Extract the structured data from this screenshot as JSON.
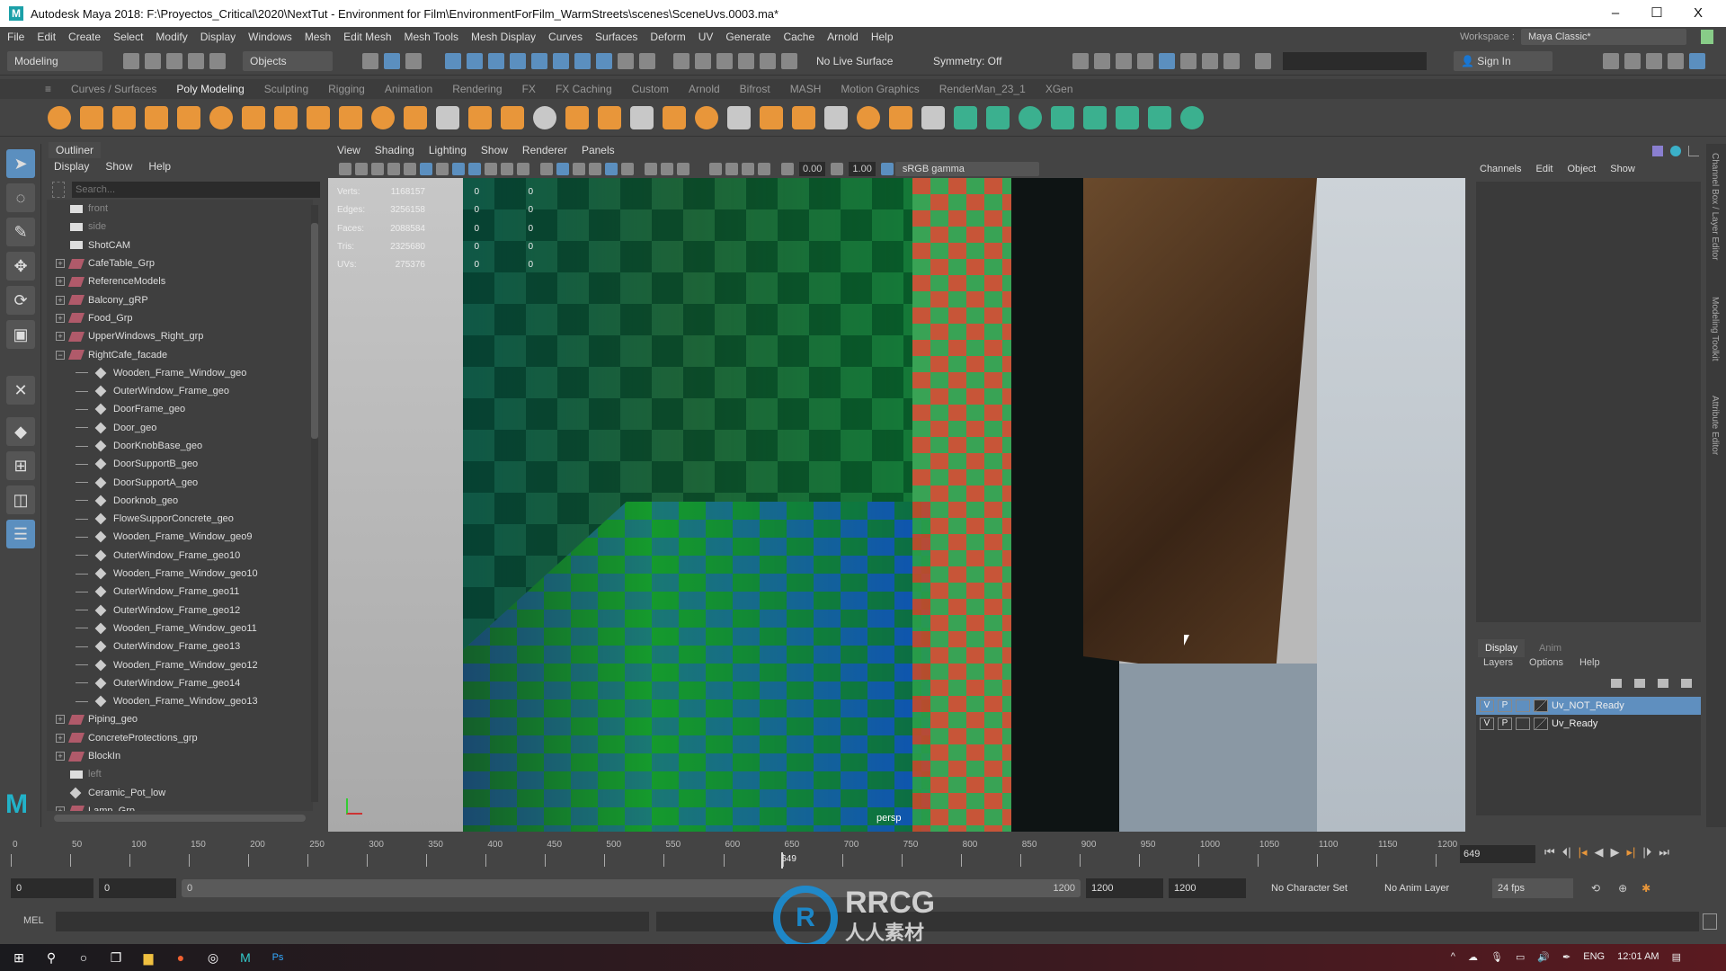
{
  "window": {
    "title": "Autodesk Maya 2018: F:\\Proyectos_Critical\\2020\\NextTut - Environment for Film\\EnvironmentForFilm_WarmStreets\\scenes\\SceneUvs.0003.ma*",
    "minimize": "–",
    "maximize": "☐",
    "close": "X"
  },
  "menubar": {
    "items": [
      "File",
      "Edit",
      "Create",
      "Select",
      "Modify",
      "Display",
      "Windows",
      "Mesh",
      "Edit Mesh",
      "Mesh Tools",
      "Mesh Display",
      "Curves",
      "Surfaces",
      "Deform",
      "UV",
      "Generate",
      "Cache",
      "Arnold",
      "Help"
    ],
    "workspace_label": "Workspace :",
    "workspace_value": "Maya Classic*"
  },
  "statusline": {
    "mode": "Modeling",
    "selection_mode": "Objects",
    "live_surface": "No Live Surface",
    "symmetry": "Symmetry: Off",
    "sign_in": "Sign In"
  },
  "shelf": {
    "tabs": [
      "Curves / Surfaces",
      "Poly Modeling",
      "Sculpting",
      "Rigging",
      "Animation",
      "Rendering",
      "FX",
      "FX Caching",
      "Custom",
      "Arnold",
      "Bifrost",
      "MASH",
      "Motion Graphics",
      "RenderMan_23_1",
      "XGen"
    ],
    "active_tab": "Poly Modeling",
    "icons": [
      "sphere",
      "cube",
      "cylinder",
      "cone",
      "torus",
      "plane",
      "disc",
      "platonic",
      "super-shape",
      "type",
      "svg",
      "combine",
      "separate",
      "extract",
      "smooth",
      "bool",
      "mirror",
      "bridge",
      "extrude",
      "bevel",
      "fill-hole",
      "append",
      "multi-cut",
      "target-weld",
      "connect",
      "quad-draw",
      "uv-editor",
      "planar-uv",
      "automatic-uv",
      "camera-uv",
      "cut-uv",
      "sew-uv",
      "unfold",
      "layout",
      "checker",
      "uv-snapshot"
    ],
    "accent": "#e8963a",
    "uv_accent": "#3bb08f"
  },
  "outliner": {
    "tab": "Outliner",
    "menu": [
      "Display",
      "Show",
      "Help"
    ],
    "search_placeholder": "Search...",
    "items": [
      {
        "label": "front",
        "type": "camera",
        "depth": 0,
        "dim": true
      },
      {
        "label": "side",
        "type": "camera",
        "depth": 0,
        "dim": true
      },
      {
        "label": "ShotCAM",
        "type": "camera",
        "depth": 0
      },
      {
        "label": "CafeTable_Grp",
        "type": "group",
        "depth": 0,
        "expand": "+"
      },
      {
        "label": "ReferenceModels",
        "type": "group",
        "depth": 0,
        "expand": "+"
      },
      {
        "label": "Balcony_gRP",
        "type": "group",
        "depth": 0,
        "expand": "+"
      },
      {
        "label": "Food_Grp",
        "type": "group",
        "depth": 0,
        "expand": "+"
      },
      {
        "label": "UpperWindows_Right_grp",
        "type": "group",
        "depth": 0,
        "expand": "+"
      },
      {
        "label": "RightCafe_facade",
        "type": "group",
        "depth": 0,
        "expand": "−"
      },
      {
        "label": "Wooden_Frame_Window_geo",
        "type": "mesh",
        "depth": 1
      },
      {
        "label": "OuterWindow_Frame_geo",
        "type": "mesh",
        "depth": 1
      },
      {
        "label": "DoorFrame_geo",
        "type": "mesh",
        "depth": 1
      },
      {
        "label": "Door_geo",
        "type": "mesh",
        "depth": 1
      },
      {
        "label": "DoorKnobBase_geo",
        "type": "mesh",
        "depth": 1
      },
      {
        "label": "DoorSupportB_geo",
        "type": "mesh",
        "depth": 1
      },
      {
        "label": "DoorSupportA_geo",
        "type": "mesh",
        "depth": 1
      },
      {
        "label": "Doorknob_geo",
        "type": "mesh",
        "depth": 1
      },
      {
        "label": "FloweSupporConcrete_geo",
        "type": "mesh",
        "depth": 1
      },
      {
        "label": "Wooden_Frame_Window_geo9",
        "type": "mesh",
        "depth": 1
      },
      {
        "label": "OuterWindow_Frame_geo10",
        "type": "mesh",
        "depth": 1
      },
      {
        "label": "Wooden_Frame_Window_geo10",
        "type": "mesh",
        "depth": 1
      },
      {
        "label": "OuterWindow_Frame_geo11",
        "type": "mesh",
        "depth": 1
      },
      {
        "label": "OuterWindow_Frame_geo12",
        "type": "mesh",
        "depth": 1
      },
      {
        "label": "Wooden_Frame_Window_geo11",
        "type": "mesh",
        "depth": 1
      },
      {
        "label": "OuterWindow_Frame_geo13",
        "type": "mesh",
        "depth": 1
      },
      {
        "label": "Wooden_Frame_Window_geo12",
        "type": "mesh",
        "depth": 1
      },
      {
        "label": "OuterWindow_Frame_geo14",
        "type": "mesh",
        "depth": 1
      },
      {
        "label": "Wooden_Frame_Window_geo13",
        "type": "mesh",
        "depth": 1
      },
      {
        "label": "Piping_geo",
        "type": "group",
        "depth": 0,
        "expand": "+"
      },
      {
        "label": "ConcreteProtections_grp",
        "type": "group",
        "depth": 0,
        "expand": "+"
      },
      {
        "label": "BlockIn",
        "type": "group",
        "depth": 0,
        "expand": "+"
      },
      {
        "label": "left",
        "type": "camera",
        "depth": 0,
        "dim": true
      },
      {
        "label": "Ceramic_Pot_low",
        "type": "mesh",
        "depth": 0
      },
      {
        "label": "Lamp_Grp",
        "type": "group",
        "depth": 0,
        "expand": "+"
      }
    ]
  },
  "viewport": {
    "menu": [
      "View",
      "Shading",
      "Lighting",
      "Show",
      "Renderer",
      "Panels"
    ],
    "exposure": "0.00",
    "gamma": "1.00",
    "color_space": "sRGB gamma",
    "camera": "persp",
    "hud": [
      {
        "label": "Verts:",
        "value": "1168157",
        "a": "0",
        "b": "0"
      },
      {
        "label": "Edges:",
        "value": "3256158",
        "a": "0",
        "b": "0"
      },
      {
        "label": "Faces:",
        "value": "2088584",
        "a": "0",
        "b": "0"
      },
      {
        "label": "Tris:",
        "value": "2325680",
        "a": "0",
        "b": "0"
      },
      {
        "label": "UVs:",
        "value": "275376",
        "a": "0",
        "b": "0"
      }
    ]
  },
  "channelbox": {
    "menu": [
      "Channels",
      "Edit",
      "Object",
      "Show"
    ]
  },
  "side_tabs": [
    "Channel Box / Layer Editor",
    "Modeling Toolkit",
    "Attribute Editor"
  ],
  "layers": {
    "tabs": [
      "Display",
      "Anim"
    ],
    "active_tab": "Display",
    "menu": [
      "Layers",
      "Options",
      "Help"
    ],
    "items": [
      {
        "v": "V",
        "p": "P",
        "name": "Uv_NOT_Ready",
        "selected": true
      },
      {
        "v": "V",
        "p": "P",
        "name": "Uv_Ready",
        "selected": false
      }
    ]
  },
  "timeline": {
    "ticks": [
      "0",
      "50",
      "100",
      "150",
      "200",
      "250",
      "300",
      "350",
      "400",
      "450",
      "500",
      "550",
      "600",
      "650",
      "700",
      "750",
      "800",
      "850",
      "900",
      "950",
      "1000",
      "1050",
      "1100",
      "1150",
      "1200"
    ],
    "current_frame": "649",
    "current_field": "649"
  },
  "range": {
    "start": "0",
    "playback_start": "0",
    "slider_start": "0",
    "slider_end": "1200",
    "playback_end": "1200",
    "end": "1200",
    "character_set": "No Character Set",
    "anim_layer": "No Anim Layer",
    "fps": "24 fps"
  },
  "mel": {
    "label": "MEL"
  },
  "taskbar": {
    "lang": "ENG",
    "time": "12:01 AM"
  },
  "watermark": {
    "brand": "RRCG",
    "sub": "人人素材"
  }
}
